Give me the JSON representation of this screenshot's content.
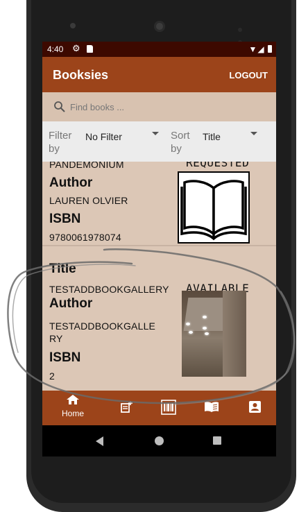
{
  "status_bar": {
    "time": "4:40"
  },
  "app_bar": {
    "title": "Booksies",
    "logout_label": "LOGOUT"
  },
  "search": {
    "placeholder": "Find books ..."
  },
  "filters": {
    "filter_label": "Filter by",
    "filter_value": "No Filter",
    "sort_label": "Sort by",
    "sort_value": "Title"
  },
  "books": [
    {
      "title_value": "PANDEMONIUM",
      "status": "REQUESTED",
      "author_heading": "Author",
      "author_value": "LAUREN OLVIER",
      "isbn_heading": "ISBN",
      "isbn_value": "9780061978074",
      "image": "book-placeholder-icon"
    },
    {
      "title_heading": "Title",
      "title_value": "TESTADDBOOKGALLERY",
      "status": "AVAILABLE",
      "author_heading": "Author",
      "author_value_line1": "TESTADDBOOKGALLE",
      "author_value_line2": "RY",
      "isbn_heading": "ISBN",
      "isbn_value": "2",
      "image": "room-ceiling-photo"
    }
  ],
  "bottom_nav": {
    "items": [
      {
        "icon": "home-icon",
        "label": "Home"
      },
      {
        "icon": "add-book-icon",
        "label": ""
      },
      {
        "icon": "barcode-scan-icon",
        "label": ""
      },
      {
        "icon": "open-book-icon",
        "label": ""
      },
      {
        "icon": "profile-icon",
        "label": ""
      }
    ]
  },
  "colors": {
    "status_bar": "#3d0900",
    "primary": "#9c441a",
    "list_background": "#dcc7b6",
    "search_background": "#d8c2b0",
    "filter_background": "#ececec"
  }
}
